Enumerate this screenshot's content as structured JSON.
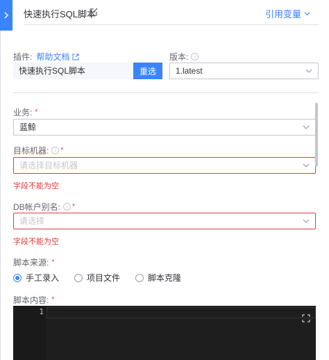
{
  "header": {
    "title": "快速执行SQL脚本",
    "variable_link": "引用变量"
  },
  "plugin": {
    "label": "插件:",
    "help_link": "帮助文档",
    "value": "快速执行SQL脚本",
    "reselect_button": "重选"
  },
  "version": {
    "label": "版本:",
    "value": "1.latest"
  },
  "business": {
    "label": "业务:",
    "required": "*",
    "value": "蓝鲸"
  },
  "target_machine": {
    "label": "目标机器:",
    "required": "*",
    "placeholder": "请选择目标机器",
    "error": "字段不能为空"
  },
  "db_alias": {
    "label": "DB帐户别名:",
    "required": "*",
    "placeholder": "请选择",
    "error": "字段不能为空"
  },
  "script_source": {
    "label": "脚本来源:",
    "required": "*",
    "options": [
      "手工录入",
      "项目文件",
      "脚本克隆"
    ],
    "selected": 0
  },
  "script_content": {
    "label": "脚本内容:",
    "required": "*",
    "line_number": "1"
  },
  "colors": {
    "accent": "#3a84ff",
    "error": "#ea3636",
    "editor_bg": "#1e1e1e"
  }
}
